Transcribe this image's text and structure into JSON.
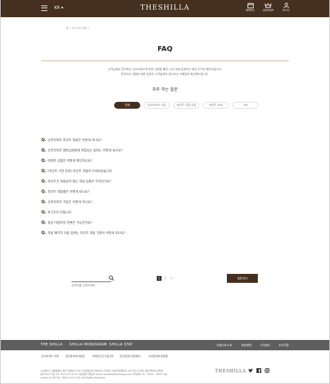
{
  "header": {
    "lang": "KR ▾",
    "logo": "THESHILLA",
    "util": [
      "예약하기",
      "신라리워즈",
      "로그인"
    ]
  },
  "breadcrumb": "홈 > 자주 하는 질문 >",
  "page_title": "FAQ",
  "intro": [
    "고객님께서 문의하신 신라리워즈에 관한 사항을 빠른 시간 내에 답변하기 위한 도우미 페이지입니다.",
    "문의하신 내용에 대한 답변은 고객님께서 접수하신 이메일로 회신해드립니다."
  ],
  "subtitle": "자주 하는 질문",
  "tabs": [
    "전체",
    "신라리워즈 가입",
    "포인트 적립·사용",
    "포인트 조회",
    "기타"
  ],
  "faq_marker": "Q.",
  "faqs": [
    "신라리워즈 포인트 적립은 어떻게 하나요?",
    "신라리워즈 멤버십회원에 포함되는 범위는 어떻게 되나요?",
    "어떠한 상품은 어떻게 확인하나요?",
    "[포인트 기한 만료] 포인트 적립이 누락되었습니다.",
    "포인트가 적립되지 않는 객실 상품은 무엇인가요?",
    "포인트 적립률은 어떻게 되나요?",
    "신라리워즈 가입은 어떻게 하나요?",
    "로그인이 안됩니다.",
    "항공 마일리지 전환은 가능한가요?",
    "객실 패키지 이용 중에는 포인트 적립 기준이 어떻게 되나요?"
  ],
  "search": {
    "placeholder": "검색어를 입력하세요"
  },
  "pager": [
    "1",
    "2",
    ">"
  ],
  "ask_button": "질문하기",
  "footer": {
    "brands": [
      "THE SHILLA",
      "SHILLA MONOGRAM",
      "SHILLA STAY"
    ],
    "links": [
      "호텔신라소개",
      "회원혜택",
      "고객센터",
      "사이트맵"
    ],
    "policies": [
      "신라리워즈 약관",
      "개인정보처리방침",
      "이메일무단수집거부",
      "윤리경영(부정제보)",
      "속성명관보관현황"
    ],
    "address": [
      "(04605) 서울특별시 중구 동호로 249 (주)호텔신라 대표이사 이부진 사업자등록번호 203-81-43363 통신판매신고번호",
      "중구00273호 TEL 02-2233-3131 개인정보 책임자 shilla.rewards@samsung.com 고객센터 02 - 0000 - 0000 Cop",
      "yright (C) HOTEL SHILLA CO.,LTD. All Rights Reserved."
    ],
    "logo": "THESHILLA"
  },
  "colors": {
    "brand": "#45301f",
    "footer": "#5e5e5e",
    "rule": "#c9b99a"
  },
  "icons": [
    "menu-icon",
    "calendar-icon",
    "crown-icon",
    "user-icon",
    "search-icon",
    "twitter-icon",
    "facebook-icon",
    "instagram-icon"
  ]
}
